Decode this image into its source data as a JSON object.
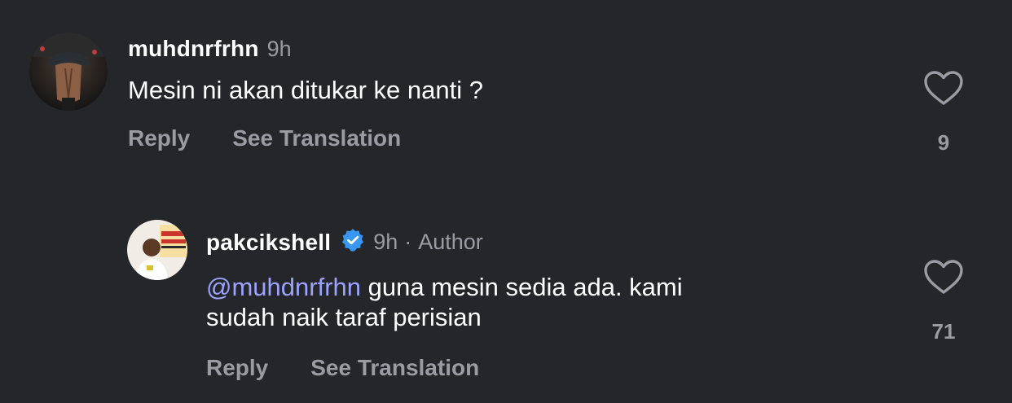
{
  "comments": [
    {
      "username": "muhdnrfrhn",
      "time": "9h",
      "text": "Mesin ni akan ditukar ke nanti ?",
      "reply_label": "Reply",
      "translate_label": "See Translation",
      "like_count": "9",
      "avatar_icon": "avatar-photo"
    },
    {
      "username": "pakcikshell",
      "verified": true,
      "time": "9h",
      "separator": "·",
      "author_badge": "Author",
      "mention": "@muhdnrfrhn",
      "text_line1": " guna mesin sedia ada. kami",
      "text_line2": "sudah naik taraf perisian",
      "reply_label": "Reply",
      "translate_label": "See Translation",
      "like_count": "71",
      "avatar_icon": "avatar-photo"
    }
  ],
  "colors": {
    "background": "#25262a",
    "muted": "#9a9ca3",
    "mention": "#9ba3ff",
    "verified": "#3897f0"
  }
}
